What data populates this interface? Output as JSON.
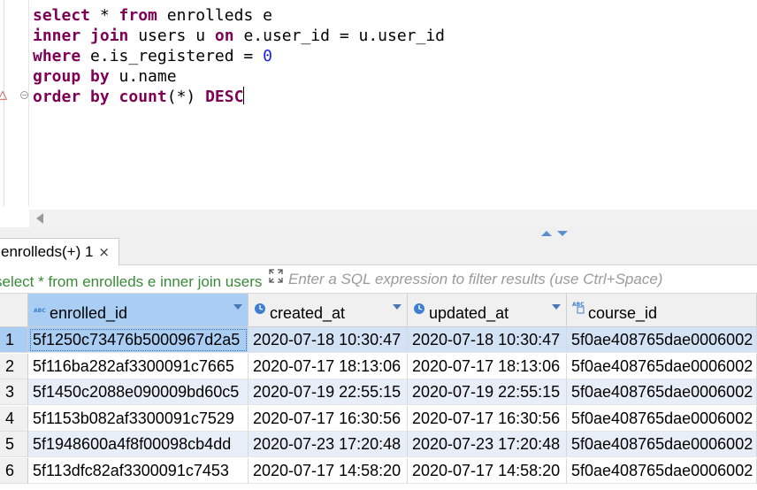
{
  "editor": {
    "lines": [
      [
        {
          "t": "select",
          "k": true
        },
        {
          "t": " * "
        },
        {
          "t": "from",
          "k": true
        },
        {
          "t": " enrolleds e"
        }
      ],
      [
        {
          "t": "inner join",
          "k": true
        },
        {
          "t": " users u "
        },
        {
          "t": "on",
          "k": true
        },
        {
          "t": " e.user_id = u.user_id"
        }
      ],
      [
        {
          "t": "where",
          "k": true
        },
        {
          "t": " e.is_registered = "
        },
        {
          "t": "0",
          "n": true
        }
      ],
      [
        {
          "t": "group by",
          "k": true
        },
        {
          "t": " u.name"
        }
      ],
      [
        {
          "t": "order by",
          "k": true
        },
        {
          "t": " "
        },
        {
          "t": "count",
          "k": true
        },
        {
          "t": "(*) "
        },
        {
          "t": "DESC",
          "k": true
        }
      ]
    ]
  },
  "result_tab": {
    "label": "enrolleds(+) 1",
    "close": "×"
  },
  "filter": {
    "query_text": "select * from enrolleds e inner join users u on e.user_id = u.user_id where e.is_registered = 0 group by u.name order by count(*) DESC",
    "placeholder": "Enter a SQL expression to filter results (use Ctrl+Space)"
  },
  "grid": {
    "columns": [
      {
        "name": "enrolled_id",
        "type_icon": "abc-text-icon"
      },
      {
        "name": "created_at",
        "type_icon": "clock-icon"
      },
      {
        "name": "updated_at",
        "type_icon": "clock-icon"
      },
      {
        "name": "course_id",
        "type_icon": "abc-key-icon"
      }
    ],
    "rows": [
      {
        "num": "1",
        "cells": [
          "5f1250c73476b5000967d2a5",
          "2020-07-18 10:30:47",
          "2020-07-18 10:30:47",
          "5f0ae408765dae0006002"
        ]
      },
      {
        "num": "2",
        "cells": [
          "5f116ba282af3300091c7665",
          "2020-07-17 18:13:06",
          "2020-07-17 18:13:06",
          "5f0ae408765dae0006002"
        ]
      },
      {
        "num": "3",
        "cells": [
          "5f1450c2088e090009bd60c5",
          "2020-07-19 22:55:15",
          "2020-07-19 22:55:15",
          "5f0ae408765dae0006002"
        ]
      },
      {
        "num": "4",
        "cells": [
          "5f1153b082af3300091c7529",
          "2020-07-17 16:30:56",
          "2020-07-17 16:30:56",
          "5f0ae408765dae0006002"
        ]
      },
      {
        "num": "5",
        "cells": [
          "5f1948600a4f8f00098cb4dd",
          "2020-07-23 17:20:48",
          "2020-07-23 17:20:48",
          "5f0ae408765dae0006002"
        ]
      },
      {
        "num": "6",
        "cells": [
          "5f113dfc82af3300091c7453",
          "2020-07-17 14:58:20",
          "2020-07-17 14:58:20",
          "5f0ae408765dae0006002"
        ]
      }
    ]
  },
  "colors": {
    "keyword": "#7f0055",
    "number": "#2020e0",
    "selection": "#a9cdf3",
    "query_text": "#3a8a3a"
  }
}
